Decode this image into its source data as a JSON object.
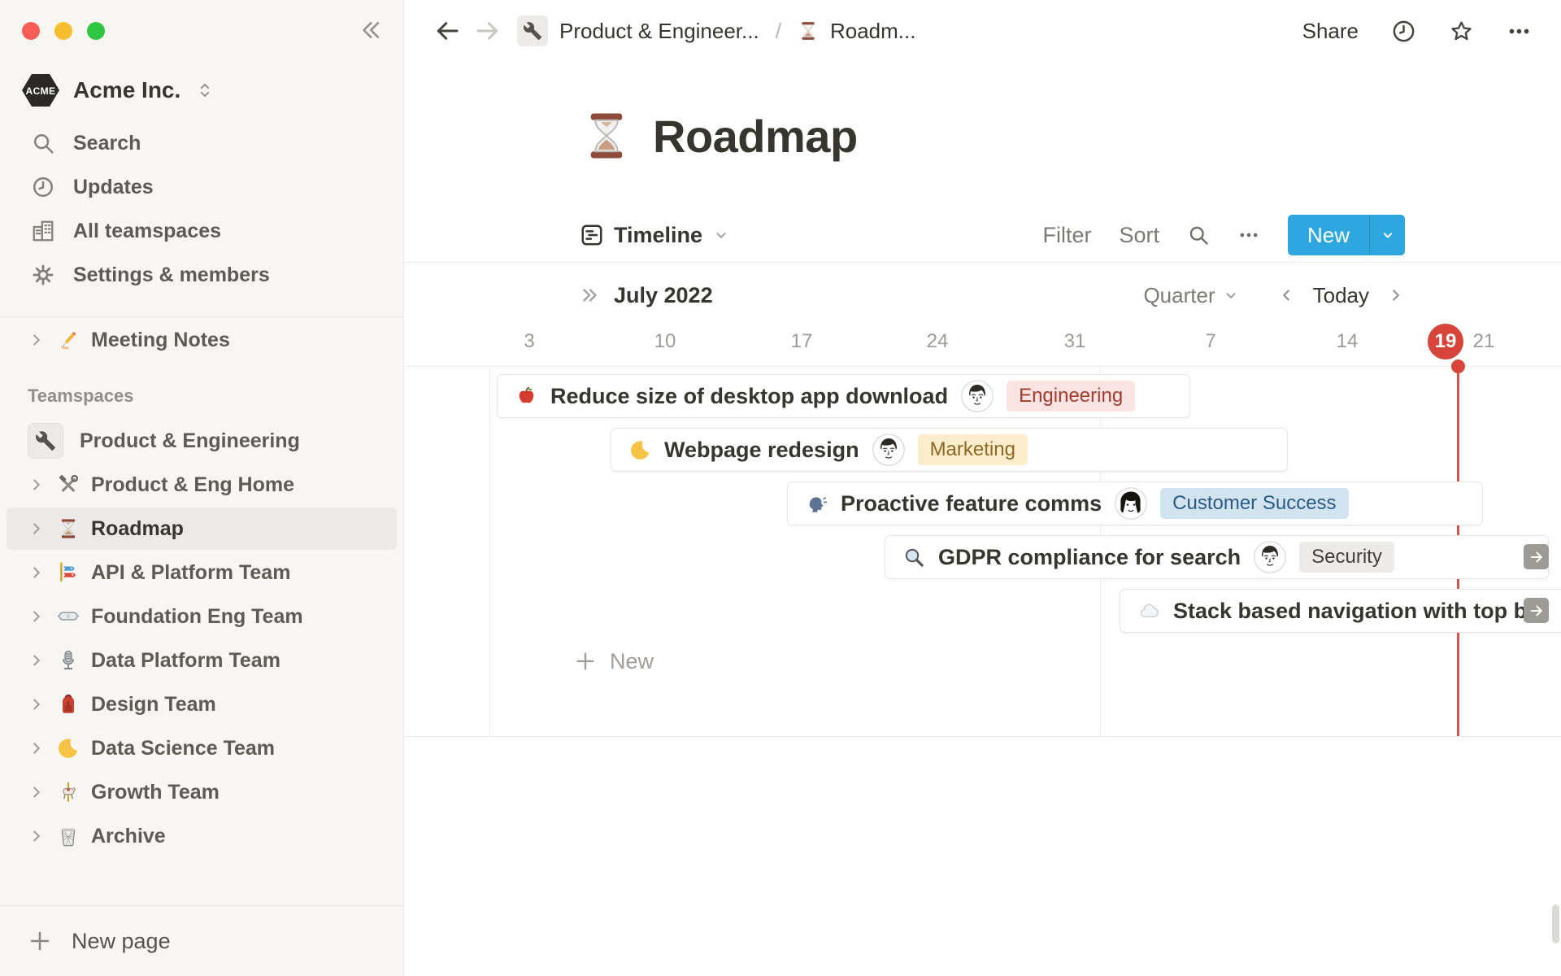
{
  "window": {
    "controls": [
      "close",
      "minimize",
      "zoom"
    ]
  },
  "sidebar": {
    "workspace": {
      "name": "Acme Inc.",
      "logo_text": "ACME"
    },
    "menu": [
      {
        "label": "Search",
        "icon": "search-icon"
      },
      {
        "label": "Updates",
        "icon": "updates-clock-icon"
      },
      {
        "label": "All teamspaces",
        "icon": "buildings-icon"
      },
      {
        "label": "Settings & members",
        "icon": "gear-icon"
      }
    ],
    "pages": [
      {
        "label": "Meeting Notes",
        "icon": "writing-hand-icon"
      }
    ],
    "teamspaces_header": "Teamspaces",
    "teamspaces": [
      {
        "label": "Product & Engineering",
        "icon": "wrench-icon"
      },
      {
        "label": "Product & Eng Home",
        "icon": "hammer-wrench-icon"
      },
      {
        "label": "Roadmap",
        "icon": "hourglass-icon",
        "selected": true
      },
      {
        "label": "API & Platform Team",
        "icon": "carp-streamer-icon"
      },
      {
        "label": "Foundation Eng Team",
        "icon": "goggles-icon"
      },
      {
        "label": "Data Platform Team",
        "icon": "microphone-icon"
      },
      {
        "label": "Design Team",
        "icon": "backpack-icon"
      },
      {
        "label": "Data Science Team",
        "icon": "crescent-moon-icon"
      },
      {
        "label": "Growth Team",
        "icon": "carousel-horse-icon"
      },
      {
        "label": "Archive",
        "icon": "wastebasket-icon"
      }
    ],
    "new_page_label": "New page"
  },
  "topbar": {
    "breadcrumb": {
      "parent": "Product & Engineer...",
      "separator": "/",
      "current": "Roadm..."
    },
    "share_label": "Share"
  },
  "page": {
    "title": "Roadmap",
    "emoji": "hourglass"
  },
  "toolbar": {
    "view_label": "Timeline",
    "filter_label": "Filter",
    "sort_label": "Sort",
    "new_label": "New"
  },
  "timeline": {
    "month_label": "July 2022",
    "zoom_label": "Quarter",
    "today_label": "Today",
    "ticks": [
      "3",
      "10",
      "17",
      "24",
      "31",
      "7",
      "14",
      "21"
    ],
    "today_date": "19",
    "cards": [
      {
        "emoji": "red-apple",
        "title": "Reduce size of desktop app download",
        "assignee": "man",
        "tag": {
          "label": "Engineering",
          "bg": "#FAE3E0",
          "fg": "#A23B30"
        }
      },
      {
        "emoji": "crescent-moon",
        "title": "Webpage redesign",
        "assignee": "man",
        "tag": {
          "label": "Marketing",
          "bg": "#FBECCB",
          "fg": "#8D6723"
        }
      },
      {
        "emoji": "speaking-head",
        "title": "Proactive feature comms",
        "assignee": "woman",
        "tag": {
          "label": "Customer Success",
          "bg": "#D2E4F0",
          "fg": "#2A5A85"
        }
      },
      {
        "emoji": "magnifying-glass",
        "title": "GDPR compliance for search",
        "assignee": "man",
        "tag": {
          "label": "Security",
          "bg": "#ECEBE8",
          "fg": "#403E3A"
        },
        "overflow_arrow": true
      },
      {
        "emoji": "cloud",
        "title": "Stack based navigation with top bar",
        "overflow_arrow": true
      }
    ],
    "new_label": "New"
  },
  "colors": {
    "accent_blue": "#2EA7DE",
    "today_red": "#D7453A",
    "sidebar_bg": "#F7F6F3",
    "selected_row_bg": "#ECEAE6"
  }
}
